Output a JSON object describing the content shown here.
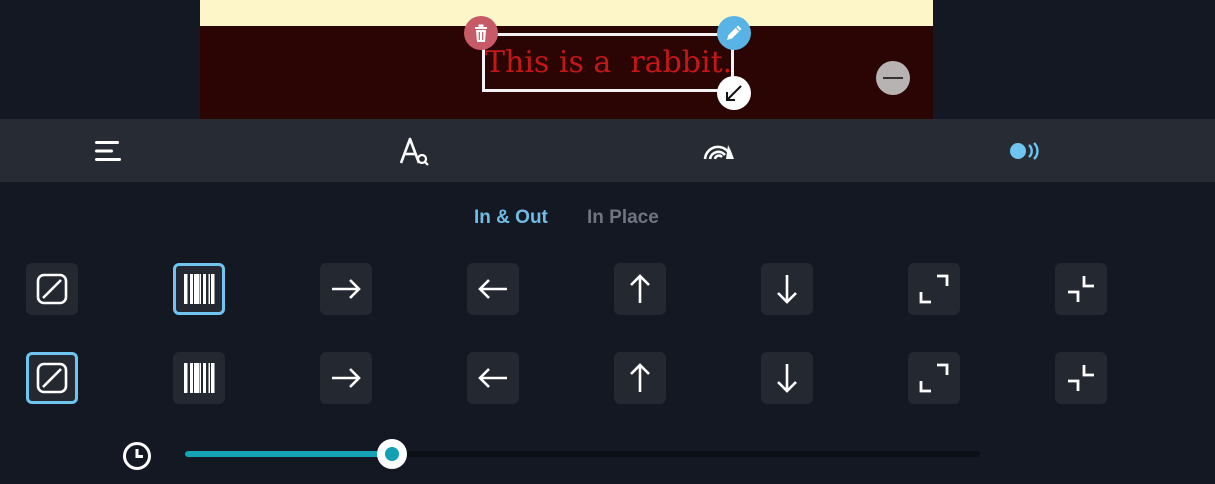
{
  "canvas": {
    "text": "This is a  rabbit.",
    "text_color": "#c41717",
    "background_color": "#2b0503",
    "top_strip_color": "#fdf6c8"
  },
  "toolbar": {
    "items": [
      {
        "icon": "align-icon"
      },
      {
        "icon": "font-icon"
      },
      {
        "icon": "effects-icon"
      },
      {
        "icon": "animation-icon",
        "active": true
      }
    ]
  },
  "tabs": {
    "in_out": "In & Out",
    "in_place": "In Place",
    "active": "in_out"
  },
  "animations": {
    "rows": [
      {
        "name": "in",
        "options": [
          "none",
          "wipe",
          "right",
          "left",
          "up",
          "down",
          "zoom-in",
          "zoom-out"
        ],
        "selected": "wipe"
      },
      {
        "name": "out",
        "options": [
          "none",
          "wipe",
          "right",
          "left",
          "up",
          "down",
          "zoom-in",
          "zoom-out"
        ],
        "selected": "none"
      }
    ]
  },
  "duration_slider": {
    "value": 0.26
  },
  "colors": {
    "accent": "#6fc5f0",
    "slider": "#16a3b5"
  }
}
